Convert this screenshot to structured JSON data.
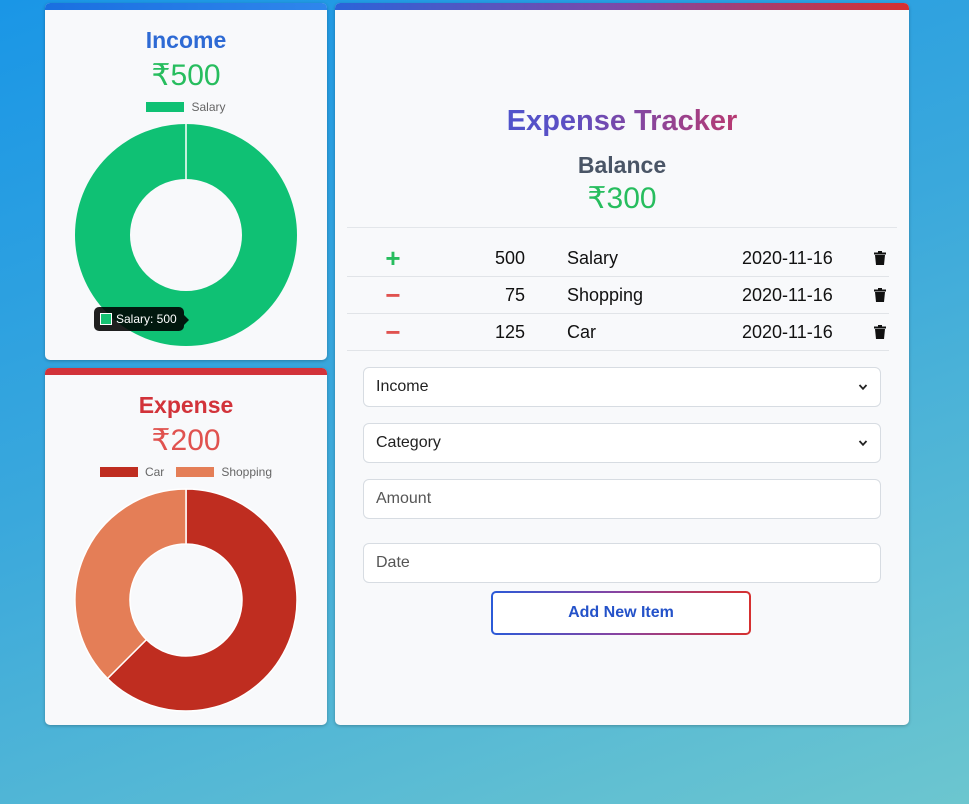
{
  "income": {
    "title": "Income",
    "amount": "₹500",
    "legend": [
      {
        "label": "Salary",
        "color": "#0fc174"
      }
    ],
    "tooltip": "Salary: 500"
  },
  "expense": {
    "title": "Expense",
    "amount": "₹200",
    "legend": [
      {
        "label": "Car",
        "color": "#bf2d20"
      },
      {
        "label": "Shopping",
        "color": "#e47e57"
      }
    ]
  },
  "main": {
    "title": "Expense Tracker",
    "balance_label": "Balance",
    "balance_amount": "₹300",
    "transactions": [
      {
        "sign": "+",
        "amount": "500",
        "category": "Salary",
        "date": "2020-11-16",
        "type": "income"
      },
      {
        "sign": "−",
        "amount": "75",
        "category": "Shopping",
        "date": "2020-11-16",
        "type": "expense"
      },
      {
        "sign": "−",
        "amount": "125",
        "category": "Car",
        "date": "2020-11-16",
        "type": "expense"
      }
    ],
    "form": {
      "type_value": "Income",
      "category_placeholder": "Category",
      "amount_placeholder": "Amount",
      "date_placeholder": "Date",
      "submit_label": "Add New Item"
    }
  },
  "chart_data": [
    {
      "type": "pie",
      "donut": true,
      "title": "Income",
      "categories": [
        "Salary"
      ],
      "values": [
        500
      ],
      "colors": [
        "#0fc174"
      ],
      "legend": "top"
    },
    {
      "type": "pie",
      "donut": true,
      "title": "Expense",
      "categories": [
        "Car",
        "Shopping"
      ],
      "values": [
        125,
        75
      ],
      "colors": [
        "#bf2d20",
        "#e47e57"
      ],
      "legend": "top"
    }
  ],
  "colors": {
    "income_green": "#27bd5e",
    "expense_red": "#d2333a",
    "income_blue": "#2e6ad4"
  }
}
